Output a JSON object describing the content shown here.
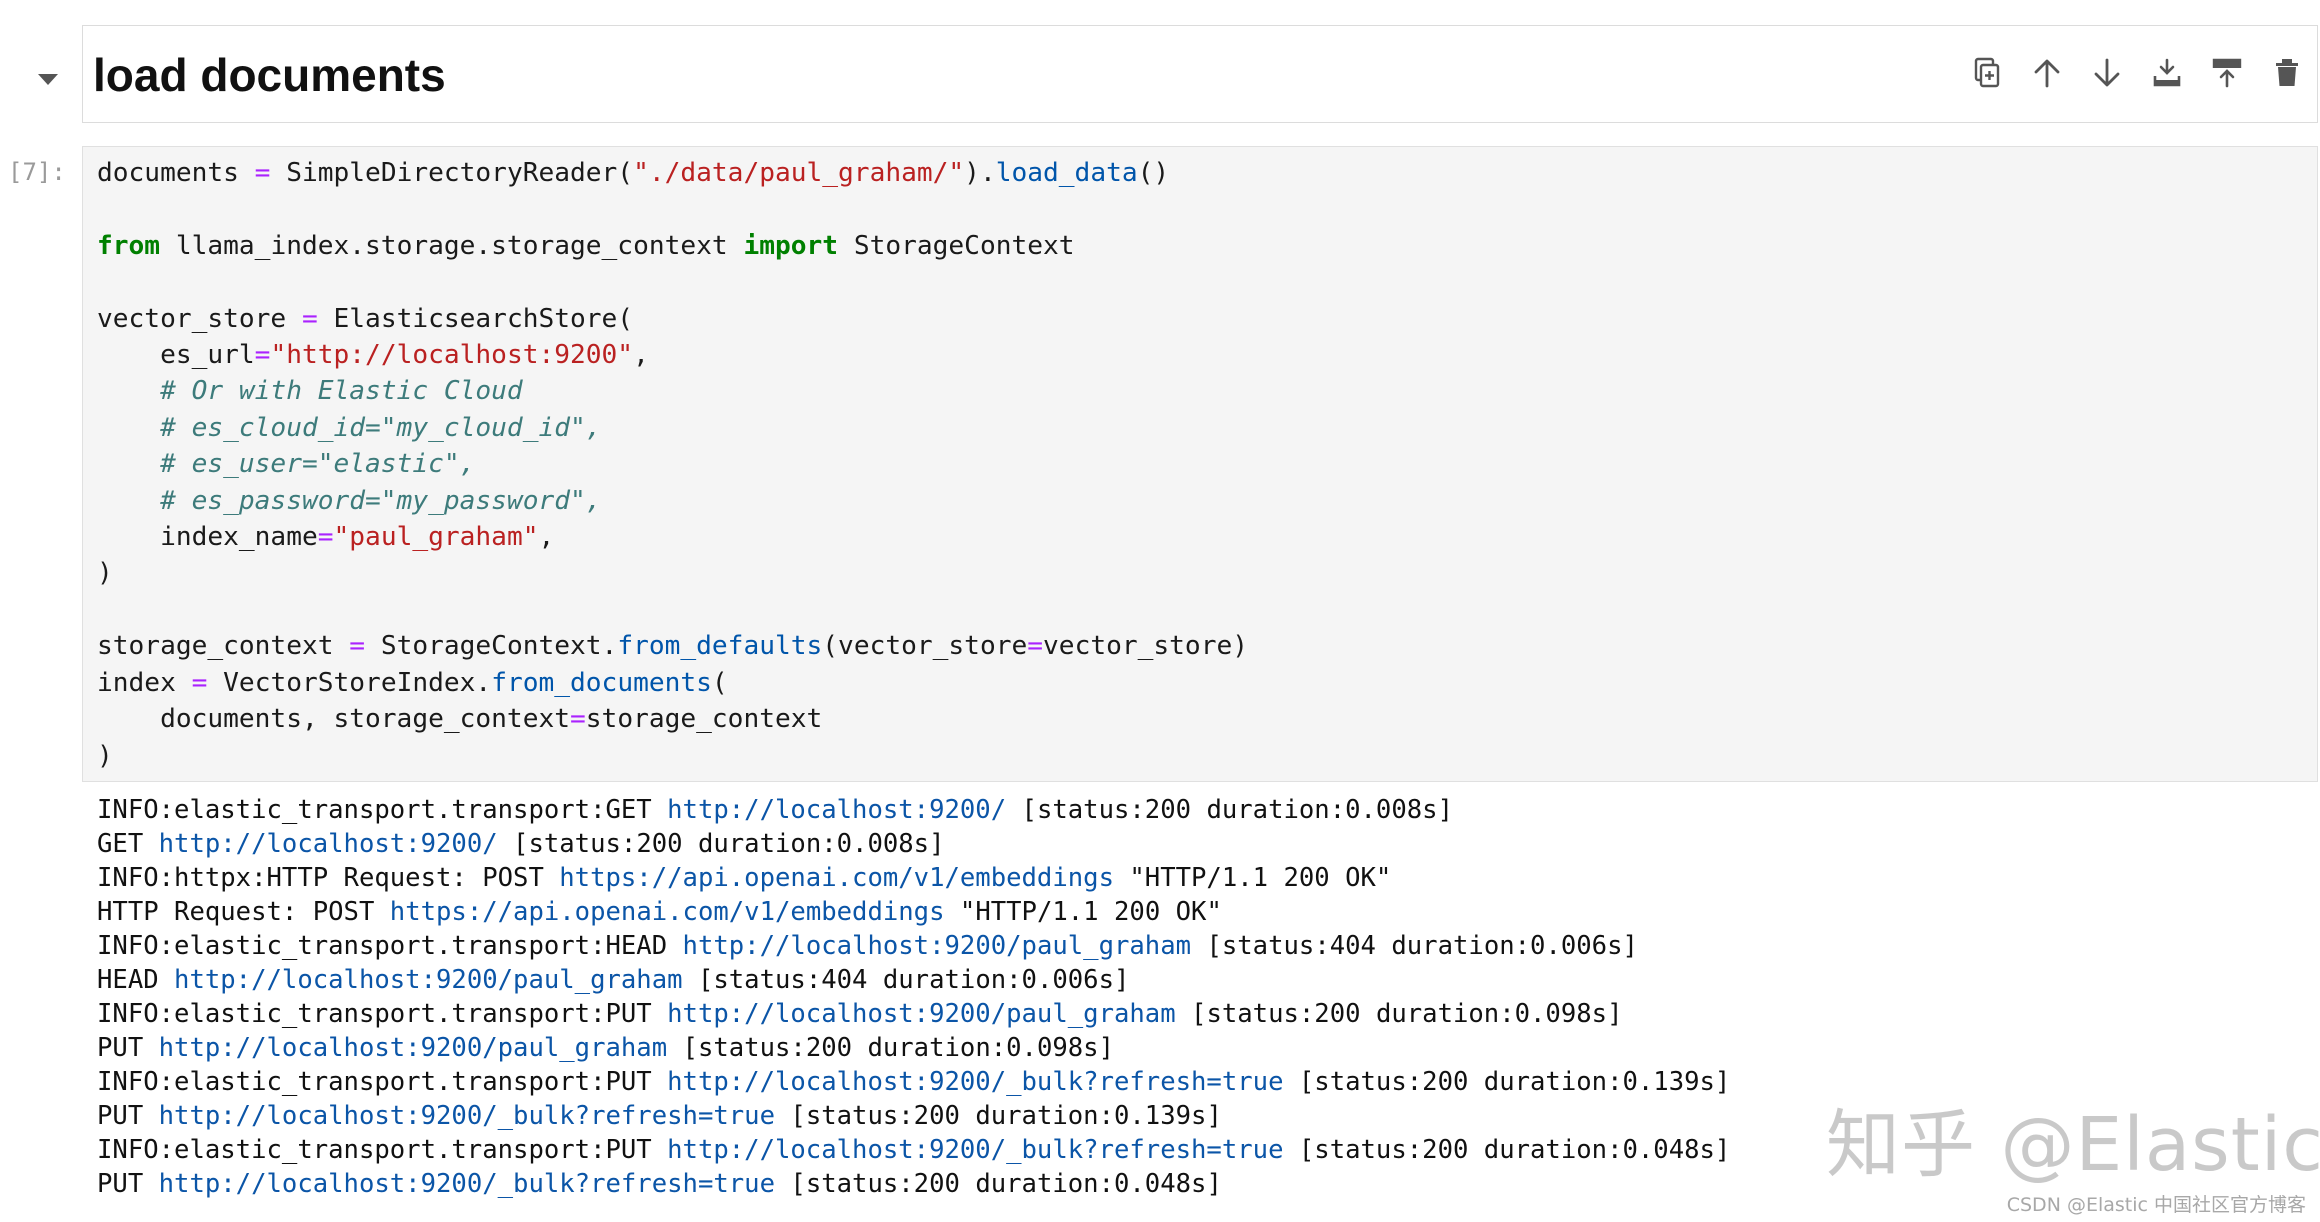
{
  "markdown_cell": {
    "heading": "load documents"
  },
  "toolbar": {
    "buttons": [
      {
        "name": "duplicate-cell-icon",
        "title": "Duplicate cell"
      },
      {
        "name": "arrow-up-icon",
        "title": "Move cell up"
      },
      {
        "name": "arrow-down-icon",
        "title": "Move cell down"
      },
      {
        "name": "insert-below-icon",
        "title": "Insert cell below"
      },
      {
        "name": "insert-above-icon",
        "title": "Insert cell above"
      },
      {
        "name": "trash-icon",
        "title": "Delete cell"
      }
    ]
  },
  "code_cell": {
    "prompt": "[7]:",
    "lines": [
      [
        [
          "documents ",
          "t"
        ],
        [
          "=",
          "op"
        ],
        [
          " SimpleDirectoryReader(",
          "t"
        ],
        [
          "\"./data/paul_graham/\"",
          "str"
        ],
        [
          ").",
          "t"
        ],
        [
          "load_data",
          "fn"
        ],
        [
          "()",
          "t"
        ]
      ],
      [],
      [
        [
          "from",
          "kw"
        ],
        [
          " llama_index.storage.storage_context ",
          "t"
        ],
        [
          "import",
          "kw"
        ],
        [
          " StorageContext",
          "t"
        ]
      ],
      [],
      [
        [
          "vector_store ",
          "t"
        ],
        [
          "=",
          "op"
        ],
        [
          " ElasticsearchStore(",
          "t"
        ]
      ],
      [
        [
          "    es_url",
          "t"
        ],
        [
          "=",
          "op"
        ],
        [
          "\"http://localhost:9200\"",
          "str"
        ],
        [
          ",",
          "t"
        ]
      ],
      [
        [
          "    # Or with Elastic Cloud",
          "cm"
        ]
      ],
      [
        [
          "    # es_cloud_id=\"my_cloud_id\",",
          "cm"
        ]
      ],
      [
        [
          "    # es_user=\"elastic\",",
          "cm"
        ]
      ],
      [
        [
          "    # es_password=\"my_password\",",
          "cm"
        ]
      ],
      [
        [
          "    index_name",
          "t"
        ],
        [
          "=",
          "op"
        ],
        [
          "\"paul_graham\"",
          "str"
        ],
        [
          ",",
          "t"
        ]
      ],
      [
        [
          ")",
          "t"
        ]
      ],
      [],
      [
        [
          "storage_context ",
          "t"
        ],
        [
          "=",
          "op"
        ],
        [
          " StorageContext.",
          "t"
        ],
        [
          "from_defaults",
          "fn"
        ],
        [
          "(vector_store",
          "t"
        ],
        [
          "=",
          "op"
        ],
        [
          "vector_store)",
          "t"
        ]
      ],
      [
        [
          "index ",
          "t"
        ],
        [
          "=",
          "op"
        ],
        [
          " VectorStoreIndex.",
          "t"
        ],
        [
          "from_documents",
          "fn"
        ],
        [
          "(",
          "t"
        ]
      ],
      [
        [
          "    documents, storage_context",
          "t"
        ],
        [
          "=",
          "op"
        ],
        [
          "storage_context",
          "t"
        ]
      ],
      [
        [
          ")",
          "t"
        ]
      ]
    ]
  },
  "output": {
    "lines": [
      [
        [
          "INFO:elastic_transport.transport:GET ",
          "t"
        ],
        [
          "http://localhost:9200/",
          "url"
        ],
        [
          " [status:200 duration:0.008s]",
          "t"
        ]
      ],
      [
        [
          "GET ",
          "t"
        ],
        [
          "http://localhost:9200/",
          "url"
        ],
        [
          " [status:200 duration:0.008s]",
          "t"
        ]
      ],
      [
        [
          "INFO:httpx:HTTP Request: POST ",
          "t"
        ],
        [
          "https://api.openai.com/v1/embeddings",
          "url"
        ],
        [
          " \"HTTP/1.1 200 OK\"",
          "t"
        ]
      ],
      [
        [
          "HTTP Request: POST ",
          "t"
        ],
        [
          "https://api.openai.com/v1/embeddings",
          "url"
        ],
        [
          " \"HTTP/1.1 200 OK\"",
          "t"
        ]
      ],
      [
        [
          "INFO:elastic_transport.transport:HEAD ",
          "t"
        ],
        [
          "http://localhost:9200/paul_graham",
          "url"
        ],
        [
          " [status:404 duration:0.006s]",
          "t"
        ]
      ],
      [
        [
          "HEAD ",
          "t"
        ],
        [
          "http://localhost:9200/paul_graham",
          "url"
        ],
        [
          " [status:404 duration:0.006s]",
          "t"
        ]
      ],
      [
        [
          "INFO:elastic_transport.transport:PUT ",
          "t"
        ],
        [
          "http://localhost:9200/paul_graham",
          "url"
        ],
        [
          " [status:200 duration:0.098s]",
          "t"
        ]
      ],
      [
        [
          "PUT ",
          "t"
        ],
        [
          "http://localhost:9200/paul_graham",
          "url"
        ],
        [
          " [status:200 duration:0.098s]",
          "t"
        ]
      ],
      [
        [
          "INFO:elastic_transport.transport:PUT ",
          "t"
        ],
        [
          "http://localhost:9200/_bulk?refresh=true",
          "url"
        ],
        [
          " [status:200 duration:0.139s]",
          "t"
        ]
      ],
      [
        [
          "PUT ",
          "t"
        ],
        [
          "http://localhost:9200/_bulk?refresh=true",
          "url"
        ],
        [
          " [status:200 duration:0.139s]",
          "t"
        ]
      ],
      [
        [
          "INFO:elastic_transport.transport:PUT ",
          "t"
        ],
        [
          "http://localhost:9200/_bulk?refresh=true",
          "url"
        ],
        [
          " [status:200 duration:0.048s]",
          "t"
        ]
      ],
      [
        [
          "PUT ",
          "t"
        ],
        [
          "http://localhost:9200/_bulk?refresh=true",
          "url"
        ],
        [
          " [status:200 duration:0.048s]",
          "t"
        ]
      ]
    ]
  },
  "watermark": {
    "text": "知乎 @Elastic",
    "credit": "CSDN @Elastic 中国社区官方博客"
  }
}
